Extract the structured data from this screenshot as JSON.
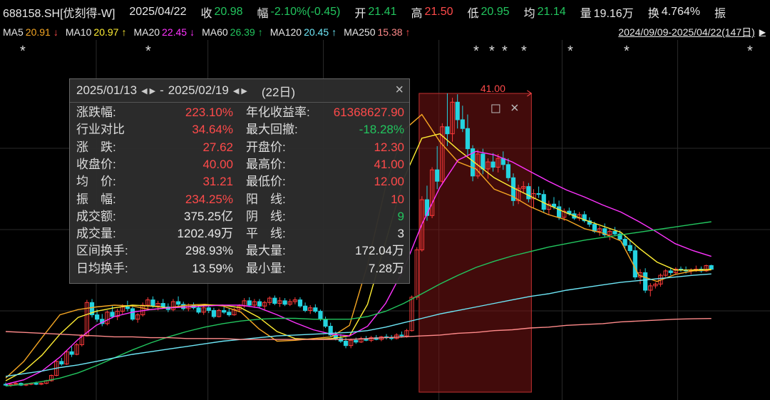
{
  "quote": {
    "code": "688158.SH[优刻得-W]",
    "date": "2025/04/22",
    "close_label": "收",
    "close": "20.98",
    "change_label": "幅",
    "change": "-2.10%(-0.45)",
    "open_label": "开",
    "open": "21.41",
    "high_label": "高",
    "high": "21.50",
    "low_label": "低",
    "low": "20.95",
    "avg_label": "均",
    "avg": "21.14",
    "vol_label": "量",
    "vol": "19.16万",
    "turnover_label": "换",
    "turnover": "4.764%",
    "amp_label": "振"
  },
  "ma_legend": [
    {
      "name": "MA5",
      "value": "20.91",
      "arrow": "↓",
      "color": "#f5a623",
      "arrow_color": "#ff4a4a"
    },
    {
      "name": "MA10",
      "value": "20.97",
      "arrow": "↑",
      "color": "#ffee33",
      "arrow_color": "#ffee33"
    },
    {
      "name": "MA20",
      "value": "22.45",
      "arrow": "↓",
      "color": "#ff33ff",
      "arrow_color": "#ff33ff"
    },
    {
      "name": "MA60",
      "value": "26.39",
      "arrow": "↑",
      "color": "#22c55e",
      "arrow_color": "#22c55e"
    },
    {
      "name": "MA120",
      "value": "20.45",
      "arrow": "↑",
      "color": "#6ee7f7",
      "arrow_color": "#6ee7f7"
    },
    {
      "name": "MA250",
      "value": "15.38",
      "arrow": "↑",
      "color": "#ff8a8a",
      "arrow_color": "#ff4a4a"
    }
  ],
  "date_range": "2024/09/09-2025/04/22(147日)",
  "date_range_arrow": "▶",
  "panel": {
    "start": "2025/01/13",
    "end": "2025/02/19",
    "nav_arrows": "◀ ▶",
    "dash": "-",
    "days": "(22日)",
    "close_icon": "×",
    "stats_left": [
      {
        "label": "涨跌幅:",
        "value": "223.10%",
        "tone": "red"
      },
      {
        "label": "行业对比",
        "value": "34.64%",
        "tone": "red"
      },
      {
        "label": "涨　跌:",
        "value": "27.62",
        "tone": "red"
      },
      {
        "label": "收盘价:",
        "value": "40.00",
        "tone": "red"
      },
      {
        "label": "均　价:",
        "value": "31.21",
        "tone": "red"
      },
      {
        "label": "振　幅:",
        "value": "234.25%",
        "tone": "red"
      },
      {
        "label": "成交额:",
        "value": "375.25亿",
        "tone": "white"
      },
      {
        "label": "成交量:",
        "value": "1202.49万",
        "tone": "white"
      },
      {
        "label": "区间换手:",
        "value": "298.93%",
        "tone": "white"
      },
      {
        "label": "日均换手:",
        "value": "13.59%",
        "tone": "white"
      }
    ],
    "stats_right": [
      {
        "label": "年化收益率:",
        "value": "61368627.90",
        "tone": "red"
      },
      {
        "label": "最大回撤:",
        "value": "-18.28%",
        "tone": "green"
      },
      {
        "label": "开盘价:",
        "value": "12.30",
        "tone": "red"
      },
      {
        "label": "最高价:",
        "value": "41.00",
        "tone": "red"
      },
      {
        "label": "最低价:",
        "value": "12.00",
        "tone": "red"
      },
      {
        "label": "阳　线:",
        "value": "10",
        "tone": "red"
      },
      {
        "label": "阴　线:",
        "value": "9",
        "tone": "green"
      },
      {
        "label": "平　线:",
        "value": "3",
        "tone": "white"
      },
      {
        "label": "最大量:",
        "value": "172.04万",
        "tone": "white"
      },
      {
        "label": "最小量:",
        "value": "7.28万",
        "tone": "white"
      }
    ]
  },
  "chart_data": {
    "type": "candlestick",
    "symbol": "688158.SH",
    "period": "2024/09/09-2025/04/22",
    "trading_days": 147,
    "ylim": [
      7,
      44
    ],
    "highlight_range": {
      "start": "2025/01/13",
      "end": "2025/02/19",
      "high": 41.0,
      "high_label": "41.00"
    },
    "star_marker": "*",
    "ohlc": [
      [
        7.9,
        8.1,
        7.7,
        7.8
      ],
      [
        7.8,
        8.0,
        7.6,
        7.9
      ],
      [
        7.9,
        8.2,
        7.8,
        8.0
      ],
      [
        8.0,
        8.1,
        7.7,
        7.8
      ],
      [
        7.8,
        8.0,
        7.7,
        7.9
      ],
      [
        7.9,
        8.1,
        7.8,
        8.0
      ],
      [
        8.0,
        8.2,
        7.8,
        7.9
      ],
      [
        7.9,
        8.1,
        7.8,
        8.0
      ],
      [
        8.0,
        8.4,
        7.9,
        8.3
      ],
      [
        8.3,
        9.0,
        8.2,
        8.9
      ],
      [
        8.9,
        10.6,
        8.8,
        10.5
      ],
      [
        10.5,
        10.9,
        10.0,
        10.2
      ],
      [
        10.2,
        11.8,
        10.1,
        11.6
      ],
      [
        11.6,
        12.2,
        11.0,
        11.3
      ],
      [
        11.3,
        12.6,
        11.2,
        12.4
      ],
      [
        12.4,
        13.6,
        12.2,
        13.4
      ],
      [
        13.4,
        17.5,
        13.3,
        17.2
      ],
      [
        17.2,
        17.6,
        15.5,
        15.8
      ],
      [
        15.8,
        16.4,
        15.0,
        15.3
      ],
      [
        15.3,
        15.9,
        14.5,
        14.8
      ],
      [
        14.8,
        16.3,
        14.6,
        16.1
      ],
      [
        16.1,
        16.8,
        15.4,
        15.6
      ],
      [
        15.6,
        16.5,
        15.2,
        16.2
      ],
      [
        16.2,
        17.0,
        15.9,
        16.7
      ],
      [
        16.7,
        17.4,
        16.2,
        16.5
      ],
      [
        16.5,
        16.8,
        15.1,
        15.3
      ],
      [
        15.3,
        16.0,
        14.9,
        15.8
      ],
      [
        15.8,
        17.2,
        15.6,
        16.9
      ],
      [
        16.9,
        17.8,
        16.5,
        17.5
      ],
      [
        17.5,
        17.9,
        16.6,
        16.8
      ],
      [
        16.8,
        17.4,
        16.3,
        17.1
      ],
      [
        17.1,
        17.6,
        16.5,
        16.7
      ],
      [
        16.7,
        17.1,
        16.1,
        16.4
      ],
      [
        16.4,
        17.6,
        16.2,
        17.3
      ],
      [
        17.3,
        17.9,
        16.8,
        17.0
      ],
      [
        17.0,
        17.3,
        16.3,
        16.5
      ],
      [
        16.5,
        17.1,
        16.2,
        16.9
      ],
      [
        16.9,
        17.2,
        16.4,
        16.6
      ],
      [
        16.6,
        16.9,
        15.9,
        16.1
      ],
      [
        16.1,
        16.8,
        15.8,
        16.6
      ],
      [
        16.6,
        16.9,
        16.0,
        16.3
      ],
      [
        16.3,
        16.6,
        15.4,
        15.6
      ],
      [
        15.6,
        16.5,
        15.5,
        16.3
      ],
      [
        16.3,
        16.7,
        15.9,
        16.1
      ],
      [
        16.1,
        16.5,
        15.6,
        15.8
      ],
      [
        15.8,
        16.6,
        15.7,
        16.4
      ],
      [
        16.4,
        17.0,
        16.1,
        16.8
      ],
      [
        16.8,
        17.7,
        16.6,
        17.4
      ],
      [
        17.4,
        17.8,
        16.7,
        16.9
      ],
      [
        16.9,
        17.6,
        16.6,
        17.3
      ],
      [
        17.3,
        17.6,
        16.6,
        16.8
      ],
      [
        16.8,
        17.4,
        16.4,
        17.2
      ],
      [
        17.2,
        17.9,
        16.9,
        17.7
      ],
      [
        17.7,
        18.0,
        16.9,
        17.1
      ],
      [
        17.1,
        17.8,
        16.7,
        17.4
      ],
      [
        17.4,
        17.7,
        16.8,
        17.0
      ],
      [
        17.0,
        17.6,
        16.8,
        17.3
      ],
      [
        17.3,
        17.8,
        17.0,
        17.5
      ],
      [
        17.5,
        17.8,
        16.6,
        16.8
      ],
      [
        16.8,
        17.2,
        16.1,
        16.3
      ],
      [
        16.3,
        16.9,
        15.9,
        16.6
      ],
      [
        16.6,
        17.0,
        16.0,
        16.2
      ],
      [
        16.2,
        16.4,
        15.1,
        15.3
      ],
      [
        15.3,
        15.6,
        14.3,
        14.5
      ],
      [
        14.5,
        14.9,
        13.3,
        13.5
      ],
      [
        13.5,
        13.9,
        12.9,
        13.1
      ],
      [
        13.1,
        13.6,
        12.6,
        12.8
      ],
      [
        12.8,
        13.2,
        12.0,
        12.3
      ],
      [
        12.3,
        13.1,
        12.0,
        12.9
      ],
      [
        12.9,
        13.2,
        12.5,
        12.7
      ],
      [
        12.7,
        13.3,
        12.6,
        13.1
      ],
      [
        13.1,
        13.4,
        12.8,
        12.9
      ],
      [
        12.9,
        13.4,
        12.7,
        13.2
      ],
      [
        13.2,
        13.5,
        12.9,
        13.0
      ],
      [
        13.0,
        13.4,
        12.8,
        13.3
      ],
      [
        13.3,
        13.6,
        13.0,
        13.2
      ],
      [
        13.2,
        13.5,
        12.9,
        13.1
      ],
      [
        13.1,
        13.7,
        13.0,
        13.5
      ],
      [
        13.5,
        13.9,
        13.2,
        13.4
      ],
      [
        13.4,
        14.2,
        13.2,
        14.0
      ],
      [
        14.0,
        18.0,
        13.9,
        17.8
      ],
      [
        17.8,
        23.5,
        17.5,
        23.2
      ],
      [
        23.2,
        29.3,
        23.0,
        28.9
      ],
      [
        28.9,
        30.5,
        26.5,
        27.1
      ],
      [
        27.1,
        32.6,
        26.8,
        32.3
      ],
      [
        32.3,
        35.0,
        30.1,
        31.0
      ],
      [
        31.0,
        37.6,
        30.6,
        37.2
      ],
      [
        37.2,
        41.0,
        35.0,
        36.4
      ],
      [
        36.4,
        40.5,
        35.5,
        40.0
      ],
      [
        40.0,
        40.9,
        37.0,
        38.0
      ],
      [
        38.0,
        39.6,
        36.6,
        37.0
      ],
      [
        37.0,
        38.6,
        34.0,
        34.7
      ],
      [
        34.7,
        35.1,
        31.0,
        31.6
      ],
      [
        31.6,
        34.6,
        31.3,
        34.1
      ],
      [
        34.1,
        34.7,
        31.8,
        32.4
      ],
      [
        32.4,
        33.6,
        31.3,
        33.2
      ],
      [
        33.2,
        34.2,
        32.1,
        32.6
      ],
      [
        32.6,
        34.1,
        32.0,
        33.6
      ],
      [
        33.6,
        34.4,
        32.3,
        32.9
      ],
      [
        32.9,
        33.6,
        31.0,
        31.4
      ],
      [
        31.4,
        31.9,
        28.2,
        28.8
      ],
      [
        28.8,
        30.6,
        28.4,
        30.2
      ],
      [
        30.2,
        31.0,
        29.6,
        30.4
      ],
      [
        30.4,
        30.8,
        28.6,
        29.0
      ],
      [
        29.0,
        30.1,
        27.9,
        29.6
      ],
      [
        29.6,
        30.4,
        29.1,
        29.5
      ],
      [
        29.5,
        30.0,
        27.4,
        27.8
      ],
      [
        27.8,
        28.8,
        27.2,
        28.4
      ],
      [
        28.4,
        29.2,
        27.8,
        28.1
      ],
      [
        28.1,
        28.8,
        26.6,
        26.9
      ],
      [
        26.9,
        27.9,
        26.5,
        27.6
      ],
      [
        27.6,
        28.0,
        27.1,
        27.3
      ],
      [
        27.3,
        27.7,
        26.6,
        26.8
      ],
      [
        26.8,
        27.5,
        26.5,
        27.2
      ],
      [
        27.2,
        27.6,
        26.3,
        26.5
      ],
      [
        26.5,
        26.9,
        25.8,
        26.1
      ],
      [
        26.1,
        26.4,
        25.1,
        25.3
      ],
      [
        25.3,
        25.9,
        24.8,
        25.6
      ],
      [
        25.6,
        26.2,
        24.6,
        24.9
      ],
      [
        24.9,
        25.6,
        24.3,
        25.3
      ],
      [
        25.3,
        25.8,
        24.8,
        25.0
      ],
      [
        25.0,
        25.4,
        24.2,
        24.4
      ],
      [
        24.4,
        24.8,
        23.4,
        23.7
      ],
      [
        23.7,
        24.3,
        22.8,
        23.1
      ],
      [
        23.1,
        23.6,
        19.8,
        20.1
      ],
      [
        20.1,
        21.0,
        19.3,
        20.6
      ],
      [
        20.6,
        21.1,
        18.3,
        18.6
      ],
      [
        18.6,
        19.4,
        17.9,
        19.1
      ],
      [
        19.1,
        19.5,
        18.8,
        19.3
      ],
      [
        19.3,
        20.5,
        19.0,
        20.3
      ],
      [
        20.3,
        21.0,
        20.1,
        20.8
      ],
      [
        20.8,
        21.2,
        20.3,
        20.6
      ],
      [
        20.6,
        21.2,
        20.4,
        21.0
      ],
      [
        21.0,
        21.3,
        20.7,
        20.9
      ],
      [
        20.9,
        21.3,
        20.5,
        20.8
      ],
      [
        20.8,
        21.1,
        20.4,
        20.9
      ],
      [
        20.9,
        21.4,
        20.7,
        21.0
      ],
      [
        21.0,
        21.3,
        20.6,
        20.8
      ],
      [
        20.8,
        21.5,
        20.7,
        21.4
      ],
      [
        21.41,
        21.5,
        20.95,
        20.98
      ]
    ],
    "ma": {
      "MA5": {
        "color": "#f5a623",
        "start": 8.6,
        "points": [
          8.6,
          10.5,
          13.2,
          15.8,
          16.4,
          16.7,
          16.9,
          16.8,
          16.4,
          16.6,
          16.9,
          17.0,
          16.8,
          16.1,
          14.2,
          12.8,
          12.9,
          13.1,
          13.3,
          14.6,
          21.5,
          30.4,
          36.8,
          38.6,
          35.5,
          33.2,
          32.4,
          30.1,
          29.3,
          28.1,
          27.2,
          26.6,
          25.6,
          25.1,
          24.2,
          20.3,
          19.6,
          20.4,
          20.8,
          20.91
        ]
      },
      "MA10": {
        "color": "#ffee33",
        "start": 8.3,
        "points": [
          8.3,
          9.4,
          11.2,
          13.6,
          15.5,
          16.2,
          16.6,
          16.9,
          16.8,
          16.6,
          16.7,
          16.9,
          16.9,
          16.6,
          15.5,
          13.9,
          13.1,
          13.0,
          13.1,
          13.4,
          17.0,
          24.1,
          31.3,
          35.9,
          36.4,
          34.6,
          33.0,
          31.4,
          30.3,
          29.3,
          28.3,
          27.4,
          26.6,
          25.9,
          25.2,
          23.4,
          21.8,
          20.9,
          20.9,
          20.97
        ]
      },
      "MA20": {
        "color": "#ff33ff",
        "start": 7.9,
        "points": [
          7.9,
          8.4,
          9.4,
          11.0,
          13.0,
          14.6,
          15.6,
          16.1,
          16.4,
          16.6,
          16.7,
          16.8,
          16.9,
          16.9,
          16.6,
          15.8,
          14.9,
          14.1,
          13.6,
          13.4,
          14.5,
          17.1,
          21.0,
          26.1,
          30.3,
          33.4,
          34.4,
          34.0,
          33.2,
          32.1,
          31.0,
          30.0,
          29.2,
          28.3,
          27.5,
          26.4,
          25.2,
          23.9,
          23.1,
          22.45
        ]
      },
      "MA60": {
        "color": "#22c55e",
        "start": 7.7,
        "points": [
          7.7,
          7.9,
          8.2,
          8.6,
          9.2,
          10.0,
          10.9,
          11.8,
          12.6,
          13.3,
          13.9,
          14.4,
          14.8,
          15.1,
          15.3,
          15.4,
          15.4,
          15.3,
          15.3,
          15.3,
          15.6,
          16.2,
          17.1,
          18.2,
          19.3,
          20.3,
          21.2,
          21.9,
          22.5,
          23.0,
          23.5,
          23.9,
          24.3,
          24.6,
          24.9,
          25.2,
          25.5,
          25.8,
          26.1,
          26.39
        ]
      },
      "MA120": {
        "color": "#6ee7f7",
        "start": 8.8,
        "points": [
          8.8,
          9.1,
          9.4,
          9.8,
          10.1,
          10.5,
          10.9,
          11.3,
          11.6,
          11.9,
          12.2,
          12.5,
          12.8,
          13.0,
          13.2,
          13.4,
          13.5,
          13.6,
          13.7,
          13.8,
          14.0,
          14.4,
          14.9,
          15.4,
          15.9,
          16.3,
          16.7,
          17.1,
          17.5,
          17.9,
          18.2,
          18.6,
          18.9,
          19.2,
          19.5,
          19.7,
          19.9,
          20.1,
          20.3,
          20.45
        ]
      },
      "MA250": {
        "color": "#ff8a8a",
        "start": 13.9,
        "points": [
          13.9,
          13.8,
          13.7,
          13.6,
          13.5,
          13.4,
          13.3,
          13.3,
          13.2,
          13.2,
          13.1,
          13.1,
          13.1,
          13.0,
          13.0,
          13.0,
          13.0,
          13.0,
          13.0,
          13.0,
          13.1,
          13.2,
          13.3,
          13.4,
          13.5,
          13.7,
          13.8,
          14.0,
          14.1,
          14.3,
          14.4,
          14.6,
          14.7,
          14.8,
          15.0,
          15.1,
          15.2,
          15.3,
          15.35,
          15.38
        ]
      }
    }
  },
  "colors": {
    "up": "#ff3b3b",
    "down": "#25d3e0",
    "highlight_fill": "rgba(120,20,20,0.55)",
    "highlight_stroke": "#c03030",
    "grid": "#2a2a2a"
  }
}
